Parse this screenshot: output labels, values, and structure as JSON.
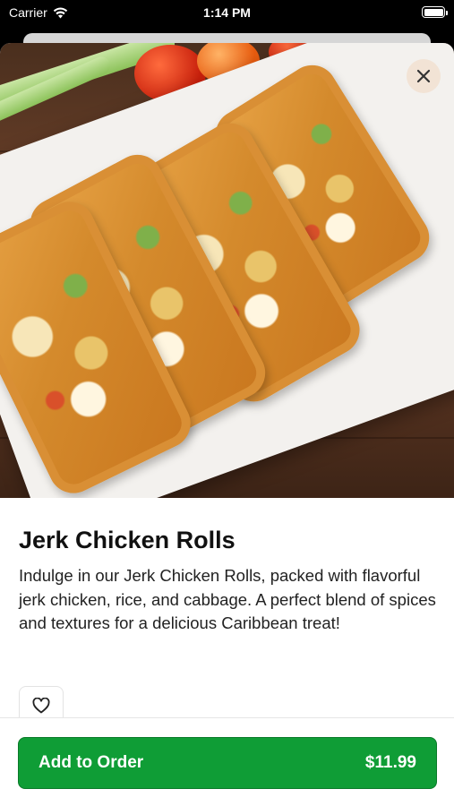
{
  "status_bar": {
    "carrier": "Carrier",
    "time": "1:14 PM",
    "wifi_icon": "wifi-icon",
    "battery_icon": "battery-icon"
  },
  "item": {
    "title": "Jerk Chicken Rolls",
    "description": "Indulge in our Jerk Chicken Rolls, packed with flavorful jerk chicken, rice, and cabbage. A perfect blend of spices and textures for a delicious Caribbean treat!",
    "image_icon": "food-photo"
  },
  "actions": {
    "close_icon": "close-icon",
    "favorite_icon": "heart-icon",
    "add_to_order_label": "Add to Order",
    "price": "$11.99"
  },
  "colors": {
    "primary": "#0f9d36",
    "close_bg": "#f2e2d2"
  }
}
